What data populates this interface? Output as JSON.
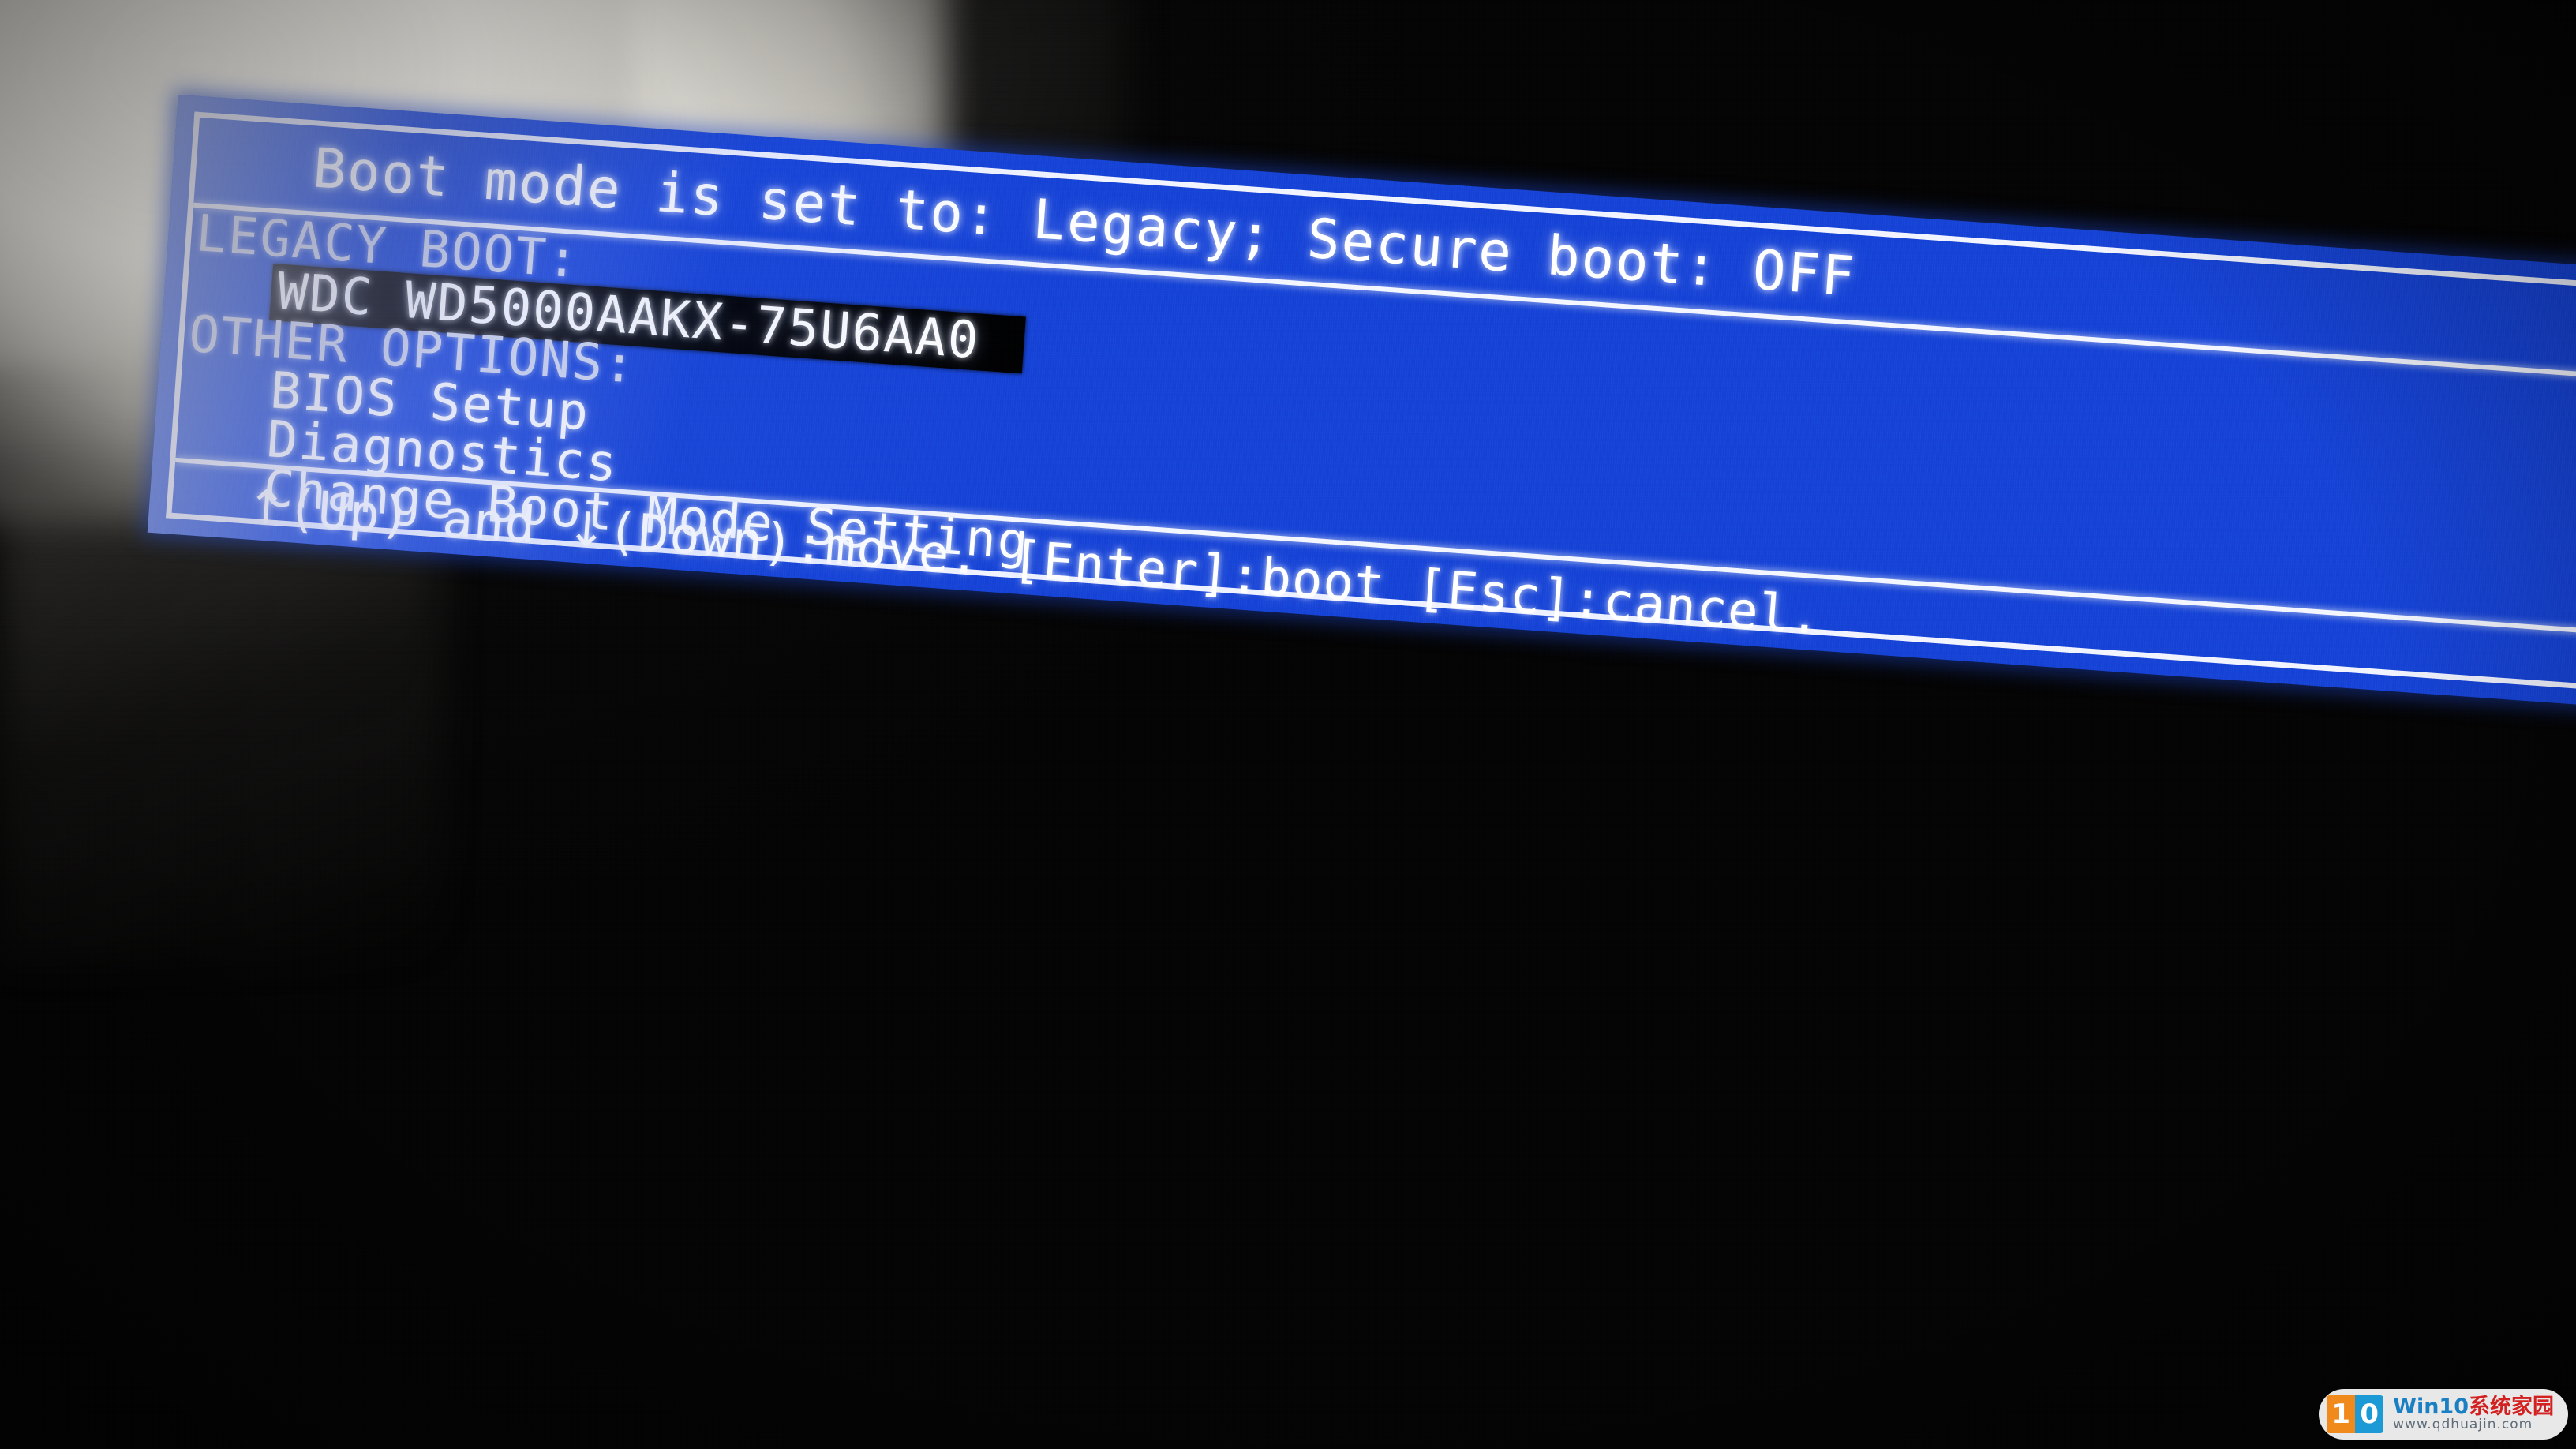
{
  "screen": {
    "header_line": "Boot mode is set to: Legacy; Secure boot: OFF",
    "sections": {
      "legacy_boot": {
        "label": "LEGACY BOOT:",
        "items": [
          {
            "label": "WDC WD5000AAKX-75U6AA0",
            "selected": true
          }
        ]
      },
      "other_options": {
        "label": "OTHER OPTIONS:",
        "items": [
          {
            "label": "BIOS Setup",
            "selected": false
          },
          {
            "label": "Diagnostics",
            "selected": false
          },
          {
            "label": "Change Boot Mode Setting",
            "selected": false
          }
        ]
      }
    },
    "footer": {
      "up_arrow": "↑",
      "up_text": "(Up) and ",
      "down_arrow": "↓",
      "down_text": "(Down):move.  [Enter]:boot  [Esc]:cancel.",
      "full": "↑(Up) and ↓(Down):move.  [Enter]:boot  [Esc]:cancel."
    },
    "colors": {
      "panel_blue": "#1745d8",
      "border_white": "#f2f4ff",
      "text_white": "#ffffff",
      "dim_label": "#d2d8ee",
      "selection_bg": "#000000"
    }
  },
  "watermark": {
    "logo_left": "1",
    "logo_right": "0",
    "title_primary": "Win10",
    "title_secondary": "系统家园",
    "url": "www.qdhuajin.com"
  }
}
